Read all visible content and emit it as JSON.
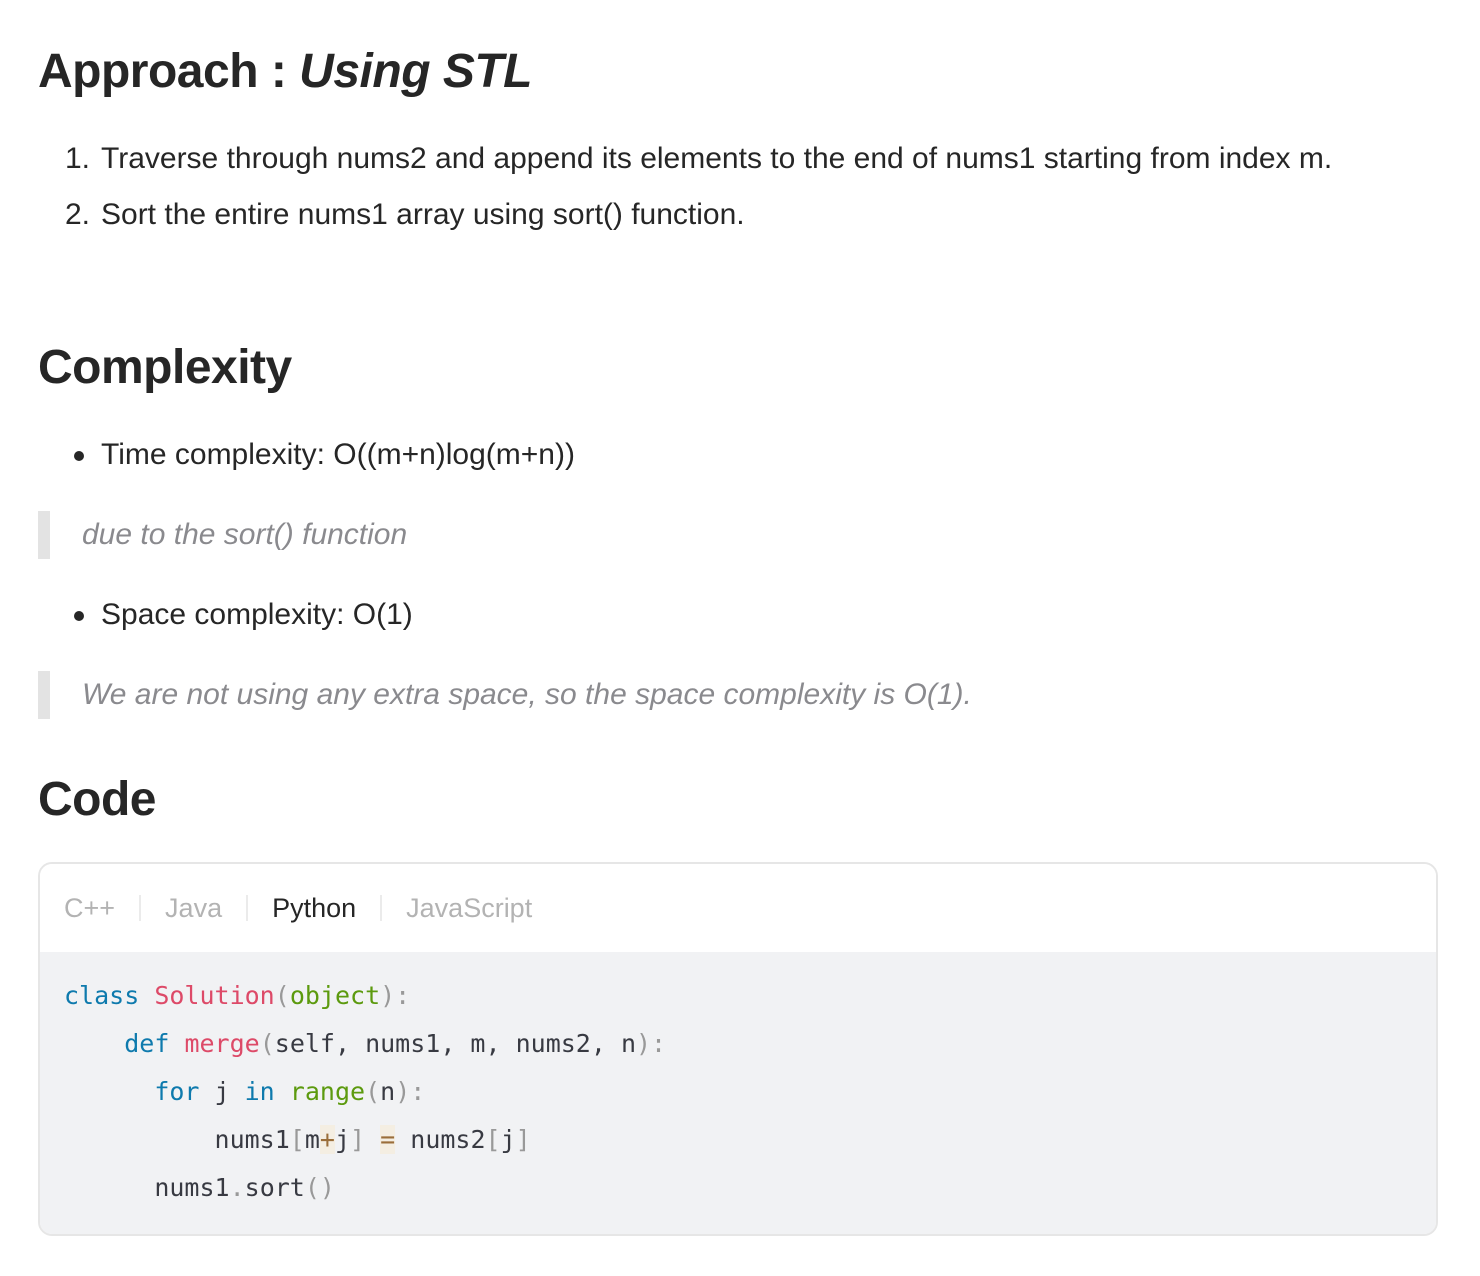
{
  "approach": {
    "heading_prefix": "Approach : ",
    "heading_emphasis": "Using STL",
    "steps": [
      {
        "number": "1.",
        "text": "Traverse through nums2 and append its elements to the end of nums1 starting from index m."
      },
      {
        "number": "2.",
        "text": "Sort the entire nums1 array using sort() function."
      }
    ]
  },
  "complexity": {
    "heading": "Complexity",
    "time": {
      "label": "Time complexity: O((m+n)log(m+n))",
      "note": "due to the sort() function"
    },
    "space": {
      "label": "Space complexity: O(1)",
      "note": "We are not using any extra space, so the space complexity is O(1)."
    }
  },
  "code": {
    "heading": "Code",
    "tabs": [
      "C++",
      "Java",
      "Python",
      "JavaScript"
    ],
    "active_tab": "Python",
    "tokens": {
      "l1_class": "class",
      "l1_name": "Solution",
      "l1_open": "(",
      "l1_base": "object",
      "l1_close": "):",
      "l2_def": "def",
      "l2_name": "merge",
      "l2_open": "(",
      "l2_params": "self, nums1, m, nums2, n",
      "l2_close": "):",
      "l3_for": "for",
      "l3_var": " j ",
      "l3_in": "in",
      "l3_range": "range",
      "l3_open": "(",
      "l3_arg": "n",
      "l3_close": "):",
      "l4_target": "nums1",
      "l4_lb": "[",
      "l4_m": "m",
      "l4_plus": "+",
      "l4_j": "j",
      "l4_rb": "]",
      "l4_eq": "=",
      "l4_src": "nums2",
      "l4_lb2": "[",
      "l4_j2": "j",
      "l4_rb2": "]",
      "l5_obj": "nums1",
      "l5_dot": ".",
      "l5_method": "sort",
      "l5_parens": "()"
    }
  },
  "colors": {
    "text": "#262626",
    "muted": "#8a8a8e",
    "keyword": "#0e7aad",
    "class_name": "#dd4a68",
    "builtin": "#5c9a0e",
    "code_bg": "#f1f2f4"
  }
}
